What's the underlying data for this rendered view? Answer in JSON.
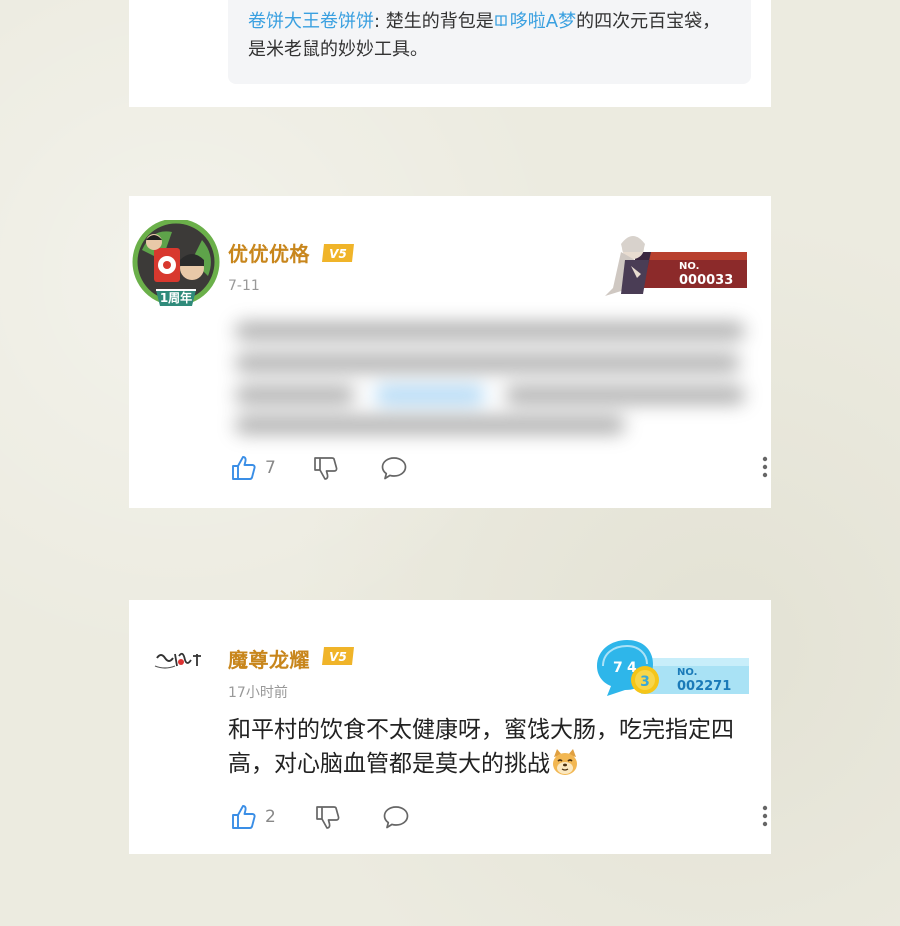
{
  "top_reply": {
    "user": "卷饼大王卷饼饼",
    "separator": ": ",
    "text_before": "楚生的背包是",
    "link": "哆啦A梦",
    "text_after": "的四次元百宝袋，是米老鼠的妙妙工具。"
  },
  "comments": [
    {
      "username": "优优优格",
      "vip_label": "V5",
      "time": "7-11",
      "avatar_badge": "1周年",
      "medal_no_label": "NO.",
      "medal_no": "000033",
      "likes": "7"
    },
    {
      "username": "魔尊龙耀",
      "vip_label": "V5",
      "time": "17小时前",
      "medal_no_label": "NO.",
      "medal_no": "002271",
      "text": "和平村的饮食不太健康呀，蜜饯大肠，吃完指定四高，对心脑血管都是莫大的挑战",
      "likes": "2"
    }
  ],
  "colors": {
    "username": "#c8861c",
    "vip_badge": "#f0b429",
    "link": "#3aa0e0",
    "icon": "#3a8ee6",
    "background": "#ecebe0"
  },
  "icons": [
    "thumbs-up-icon",
    "thumbs-down-icon",
    "comment-icon",
    "more-vertical-icon",
    "book-icon",
    "doge-emoji"
  ]
}
